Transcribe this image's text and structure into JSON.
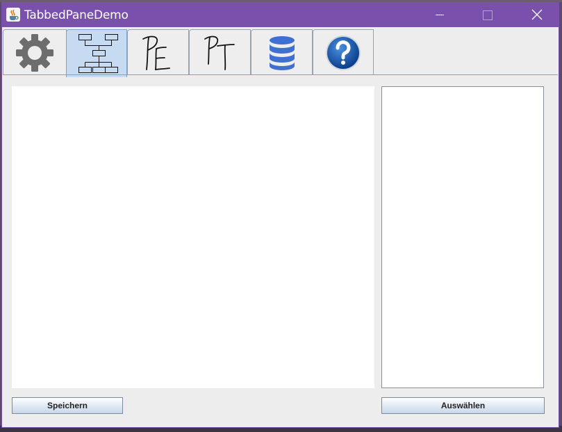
{
  "window": {
    "title": "TabbedPaneDemo",
    "controls": {
      "minimize_icon": "minimize-icon",
      "maximize_icon": "maximize-icon",
      "close_icon": "close-icon"
    },
    "titlebar_color": "#7950ab"
  },
  "tabs": [
    {
      "icon": "gear-icon",
      "selected": false
    },
    {
      "icon": "hierarchy-diagram-icon",
      "selected": true
    },
    {
      "icon": "pe-handwritten-icon",
      "selected": false,
      "text": "PE"
    },
    {
      "icon": "pt-handwritten-icon",
      "selected": false,
      "text": "PT"
    },
    {
      "icon": "database-icon",
      "selected": false
    },
    {
      "icon": "help-icon",
      "selected": false
    }
  ],
  "buttons": {
    "save_label": "Speichern",
    "select_label": "Auswählen"
  },
  "colors": {
    "selected_tab": "#c6daf2",
    "database_blue": "#3f6fd1",
    "help_blue": "#1a5fb4"
  }
}
